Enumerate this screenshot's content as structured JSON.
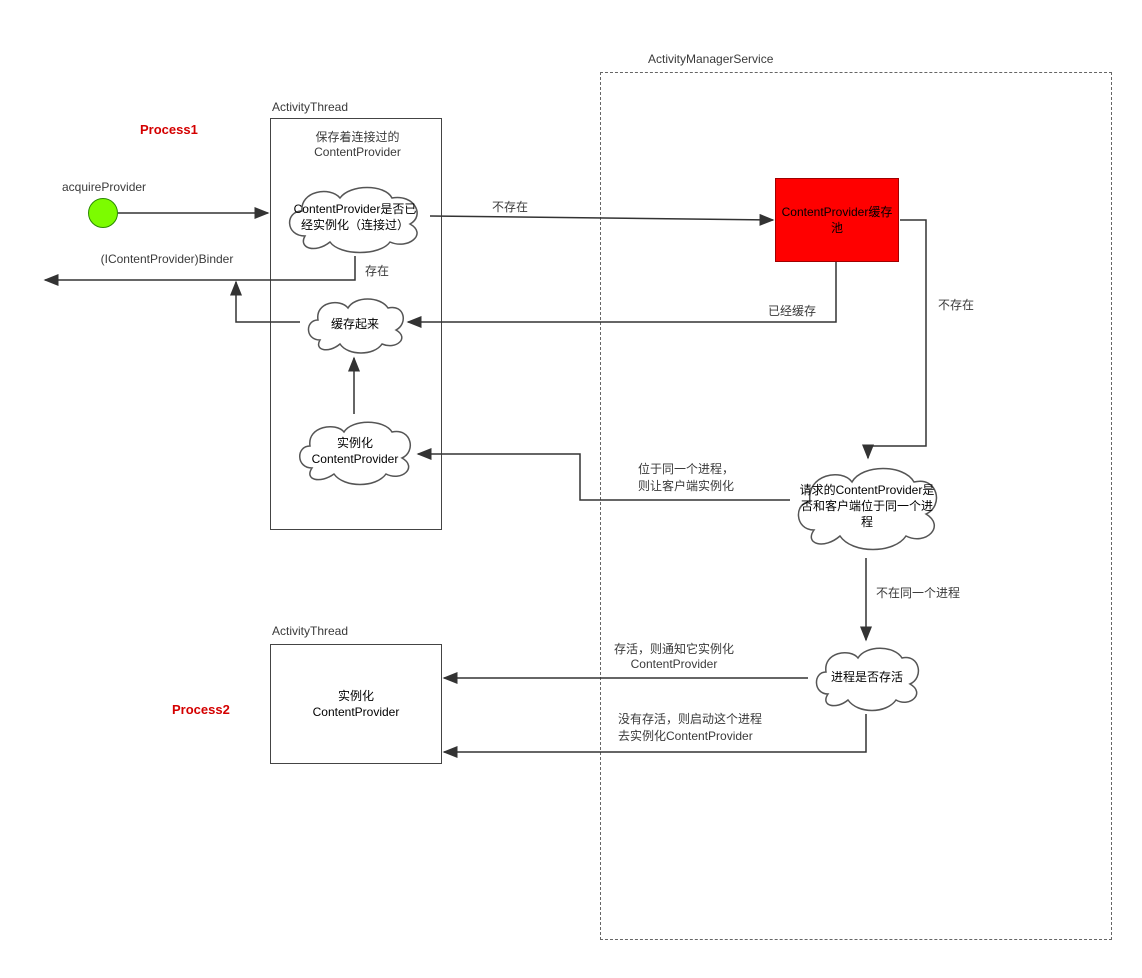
{
  "labels": {
    "process1": "Process1",
    "process2": "Process2",
    "acquireProvider": "acquireProvider",
    "icontentProviderBinder": "(IContentProvider)Binder",
    "activityThread1": "ActivityThread",
    "activityThread2": "ActivityThread",
    "activityManagerService": "ActivityManagerService",
    "savedConnected": "保存着连接过的\nContentProvider",
    "cloudIsInstantiated": "ContentProvider是否已经实例化（连接过）",
    "exists": "存在",
    "notExist": "不存在",
    "cacheIt": "缓存起来",
    "instantiateCP1": "实例化\nContentProvider",
    "contentProviderCachePool": "ContentProvider缓存池",
    "alreadyCached": "已经缓存",
    "notExist2": "不存在",
    "cloudSameProcess": "请求的ContentProvider是否和客户端位于同一个进程",
    "sameProcessLabel": "位于同一个进程，\n则让客户端实例化",
    "notSameProcess": "不在同一个进程",
    "cloudProcessAlive": "进程是否存活",
    "aliveNotify": "存活，则通知它实例化\nContentProvider",
    "notAliveStart": "没有存活，则启动这个进程\n去实例化ContentProvider",
    "instantiateCP2": "实例化\nContentProvider"
  }
}
